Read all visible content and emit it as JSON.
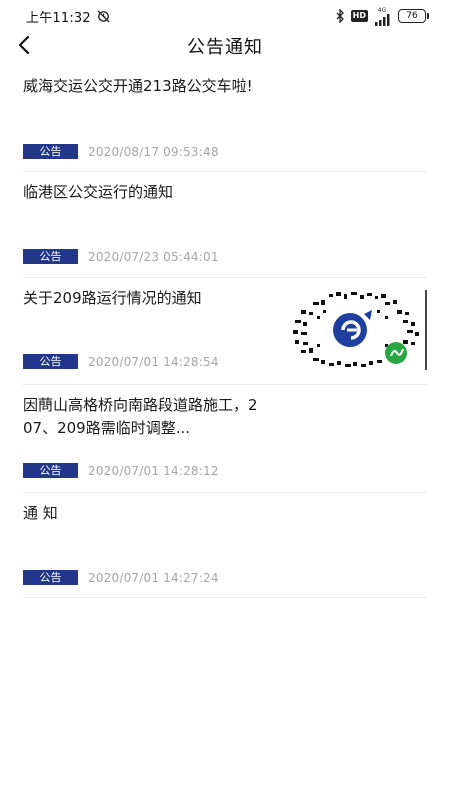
{
  "status_bar": {
    "time": "上午11:32",
    "network_label": "4G",
    "battery_level": "76"
  },
  "header": {
    "title": "公告通知"
  },
  "notices": [
    {
      "title": "威海交运公交开通213路公交车啦!",
      "tag": "公告",
      "date": "2020/08/17 09:53:48",
      "has_thumbnail": false
    },
    {
      "title": "临港区公交运行的通知",
      "tag": "公告",
      "date": "2020/07/23 05:44:01",
      "has_thumbnail": false
    },
    {
      "title": "关于209路运行情况的通知",
      "tag": "公告",
      "date": "2020/07/01 14:28:54",
      "has_thumbnail": true,
      "thumbnail_icon": "mini-program-qr-code"
    },
    {
      "title": "因蔄山高格桥向南路段道路施工，207、209路需临时调整...",
      "tag": "公告",
      "date": "2020/07/01 14:28:12",
      "has_thumbnail": false
    },
    {
      "title": "通 知",
      "tag": "公告",
      "date": "2020/07/01 14:27:24",
      "has_thumbnail": false
    }
  ],
  "colors": {
    "tag_background": "#22378a",
    "tag_text": "#ffffff",
    "date_text": "#a6a6a6",
    "divider": "#ececec"
  }
}
